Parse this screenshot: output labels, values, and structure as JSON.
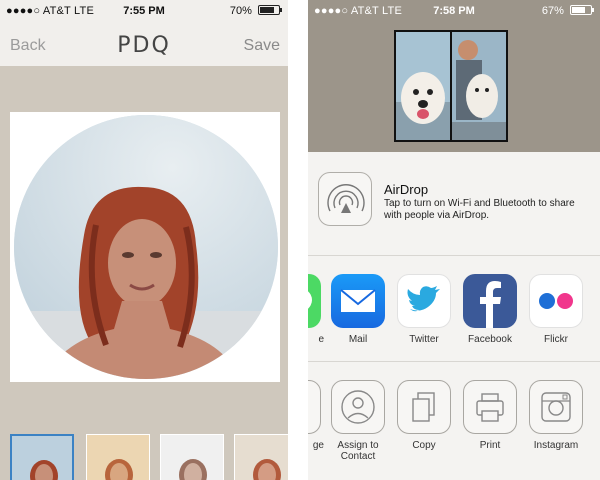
{
  "left_screen": {
    "status": {
      "carrier": "●●●●○ AT&T  LTE",
      "time": "7:55 PM",
      "battery": "70%",
      "battery_level": 0.7
    },
    "nav": {
      "back_label": "Back",
      "logo": "PDQ",
      "save_label": "Save"
    }
  },
  "right_screen": {
    "status": {
      "carrier": "●●●●○ AT&T  LTE",
      "time": "7:58 PM",
      "battery": "67%",
      "battery_level": 0.67
    },
    "airdrop": {
      "title": "AirDrop",
      "description": "Tap to turn on Wi-Fi and Bluetooth to share with people via AirDrop."
    },
    "share_apps": [
      {
        "label": "e",
        "icon": "messages-icon",
        "color": "#4cd964"
      },
      {
        "label": "Mail",
        "icon": "mail-icon",
        "color": "#1e88f2"
      },
      {
        "label": "Twitter",
        "icon": "twitter-icon",
        "color": "#ffffff"
      },
      {
        "label": "Facebook",
        "icon": "facebook-icon",
        "color": "#3b5998"
      },
      {
        "label": "Flickr",
        "icon": "flickr-icon",
        "color": "#ffffff"
      }
    ],
    "actions": [
      {
        "label": "ge",
        "icon": "message-icon"
      },
      {
        "label": "Assign to Contact",
        "icon": "contact-icon"
      },
      {
        "label": "Copy",
        "icon": "copy-icon"
      },
      {
        "label": "Print",
        "icon": "print-icon"
      },
      {
        "label": "Instagram",
        "icon": "instagram-icon"
      }
    ]
  }
}
